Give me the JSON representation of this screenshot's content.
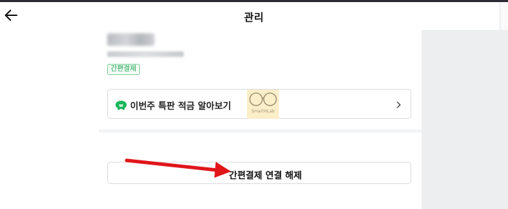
{
  "header": {
    "title": "관리",
    "back_icon": "arrow-left-icon"
  },
  "account": {
    "badge": "간편결제"
  },
  "promo": {
    "label": "이번주 특판 적금 알아보기",
    "icon": "piggy-bank-icon",
    "chevron": "chevron-right-icon",
    "watermark": "SmartHLab"
  },
  "actions": {
    "unlink_label": "간편결제 연결 해제"
  },
  "colors": {
    "accent_green": "#1aa34a",
    "annotation_red": "#e0161b"
  }
}
